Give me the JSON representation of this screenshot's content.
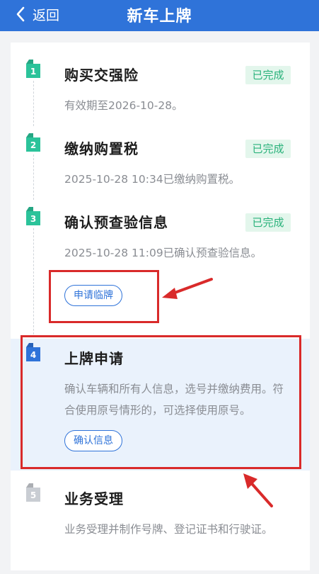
{
  "header": {
    "back_label": "返回",
    "title": "新车上牌",
    "background": "#2f73d9"
  },
  "steps": [
    {
      "number": "1",
      "title": "购买交强险",
      "status": "已完成",
      "description": "有效期至2026-10-28。"
    },
    {
      "number": "2",
      "title": "缴纳购置税",
      "status": "已完成",
      "description": "2025-10-28 10:34已缴纳购置税。"
    },
    {
      "number": "3",
      "title": "确认预查验信息",
      "status": "已完成",
      "description": "2025-10-28 11:09已确认预查验信息。",
      "action_label": "申请临牌"
    },
    {
      "number": "4",
      "title": "上牌申请",
      "description": "确认车辆和所有人信息，选号并缴纳费用。符合使用原号情形的，可选择使用原号。",
      "action_label": "确认信息"
    },
    {
      "number": "5",
      "title": "业务受理",
      "description": "业务受理并制作号牌、登记证书和行驶证。"
    }
  ],
  "colors": {
    "done_green": "#2bc39a",
    "active_blue": "#2f73d9",
    "pending_gray": "#c9cdd3",
    "annotation_red": "#d92a2a"
  }
}
